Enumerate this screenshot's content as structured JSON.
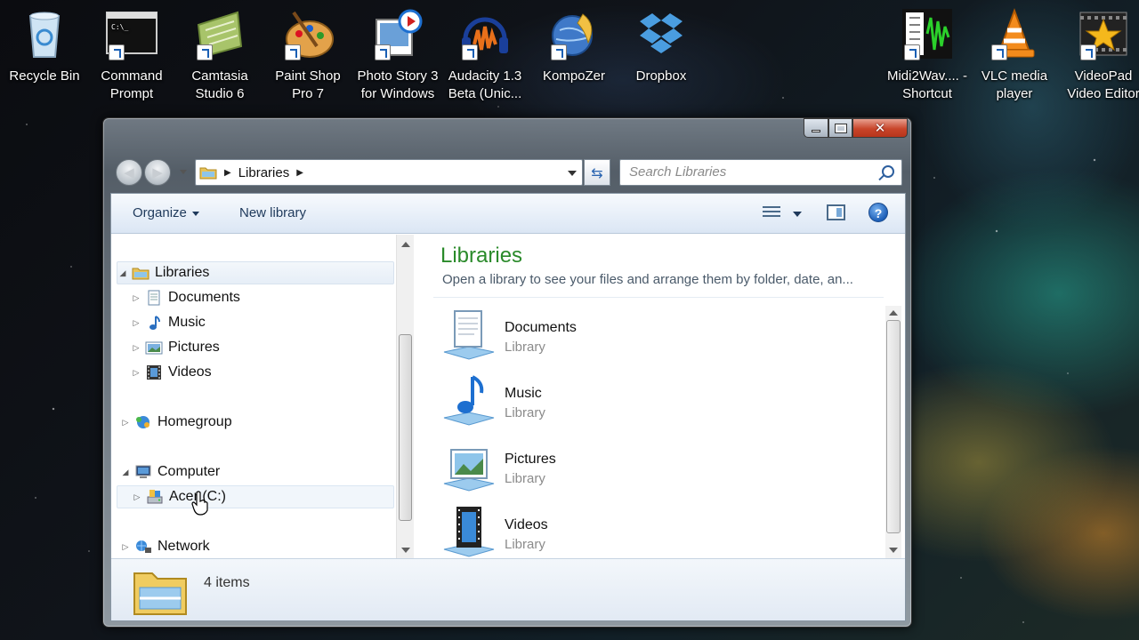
{
  "desktop": {
    "icons": [
      {
        "label": "Recycle Bin",
        "name": "recycle-bin-icon"
      },
      {
        "label": "Command Prompt",
        "name": "command-prompt-icon"
      },
      {
        "label": "Camtasia Studio 6",
        "name": "camtasia-icon"
      },
      {
        "label": "Paint Shop Pro 7",
        "name": "paint-shop-pro-icon"
      },
      {
        "label": "Photo Story 3 for Windows",
        "name": "photo-story-icon"
      },
      {
        "label": "Audacity 1.3 Beta (Unic...",
        "name": "audacity-icon"
      },
      {
        "label": "KompoZer",
        "name": "kompozer-icon"
      },
      {
        "label": "Dropbox",
        "name": "dropbox-icon"
      },
      {
        "label": "Midi2Wav.... - Shortcut",
        "name": "midi2wav-icon"
      },
      {
        "label": "VLC media player",
        "name": "vlc-icon"
      },
      {
        "label": "VideoPad Video Editor",
        "name": "videopad-icon"
      }
    ]
  },
  "window": {
    "close_glyph": "✕",
    "address": {
      "segment": "Libraries"
    },
    "search": {
      "placeholder": "Search Libraries"
    },
    "toolbar": {
      "organize": "Organize",
      "new_library": "New library",
      "help": "?"
    },
    "nav_tree": {
      "libraries": "Libraries",
      "documents": "Documents",
      "music": "Music",
      "pictures": "Pictures",
      "videos": "Videos",
      "homegroup": "Homegroup",
      "computer": "Computer",
      "drive": "Acer (C:)",
      "network": "Network"
    },
    "content": {
      "title": "Libraries",
      "subtitle": "Open a library to see your files and arrange them by folder, date, an...",
      "items": [
        {
          "name": "Documents",
          "kind": "Library"
        },
        {
          "name": "Music",
          "kind": "Library"
        },
        {
          "name": "Pictures",
          "kind": "Library"
        },
        {
          "name": "Videos",
          "kind": "Library"
        }
      ]
    },
    "details": {
      "count": "4 items"
    }
  },
  "colors": {
    "title_green": "#2a8a2a",
    "toolbar_text": "#1e395b",
    "close_red": "#c8452a"
  }
}
